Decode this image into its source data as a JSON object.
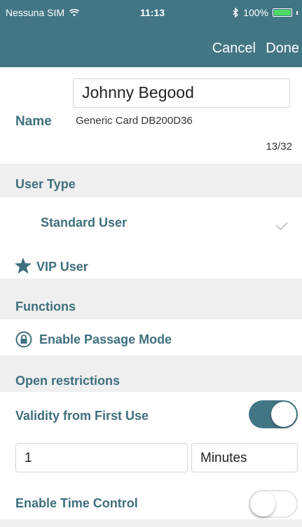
{
  "status_bar": {
    "carrier": "Nessuna SIM",
    "wifi_icon": "wifi-icon",
    "time": "11:13",
    "bluetooth_icon": "bluetooth-icon",
    "battery": "100%",
    "battery_level": 1.0
  },
  "nav": {
    "cancel": "Cancel",
    "done": "Done"
  },
  "name_section": {
    "label": "Name",
    "value": "Johnny Begood",
    "card_name": "Generic Card DB200D36",
    "char_count": "13/32"
  },
  "user_type": {
    "header": "User Type",
    "options": [
      {
        "label": "Standard User",
        "selected": true
      },
      {
        "label": "VIP User",
        "icon": "star-icon",
        "selected": false
      }
    ]
  },
  "functions": {
    "header": "Functions",
    "passage_mode": {
      "label": "Enable Passage Mode",
      "icon": "lock-circle-icon"
    }
  },
  "open_restrictions": {
    "header": "Open restrictions",
    "validity": {
      "label": "Validity from First Use",
      "enabled": true
    },
    "duration_value": "1",
    "duration_unit": "Minutes",
    "time_control": {
      "label": "Enable Time Control",
      "enabled": false
    }
  },
  "colors": {
    "accent": "#427685",
    "label": "#3f6f7e",
    "section_bg": "#efefef",
    "toggle_on": "#427685"
  }
}
